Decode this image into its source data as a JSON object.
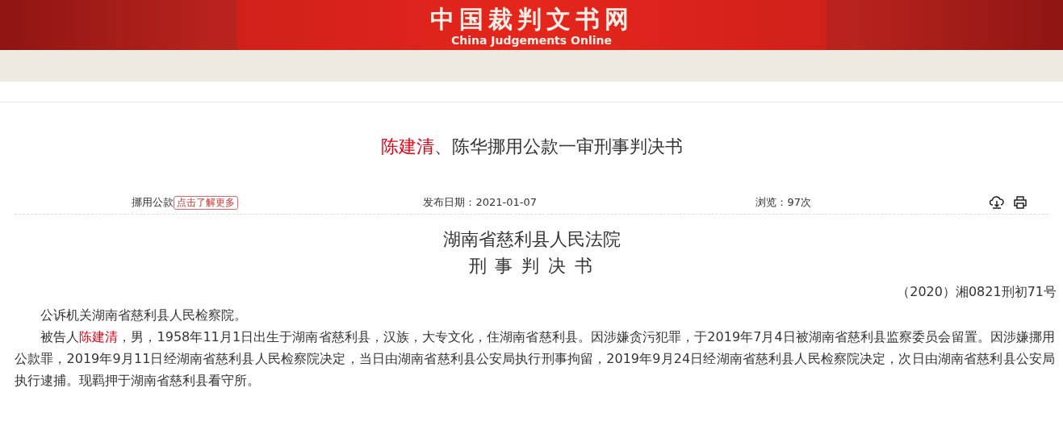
{
  "header": {
    "title": "中国裁判文书网",
    "subtitle": "China Judgements Online"
  },
  "document": {
    "title_parts": [
      {
        "text": "陈建清",
        "highlight": true
      },
      {
        "text": "、陈华挪用公款一审刑事判决书",
        "highlight": false
      }
    ],
    "cause": "挪用公款",
    "more_link": "点击了解更多",
    "publish_date": "发布日期：2021-01-07",
    "views": "浏览：97次",
    "court": "湖南省慈利县人民法院",
    "doc_type": "刑 事 判 决 书",
    "case_number": "（2020）湘0821刑初71号",
    "paragraphs": [
      [
        {
          "text": "公诉机关湖南省慈利县人民检察院。",
          "highlight": false
        }
      ],
      [
        {
          "text": "被告人",
          "highlight": false
        },
        {
          "text": "陈建清",
          "highlight": true
        },
        {
          "text": "，男，1958年11月1日出生于湖南省慈利县，汉族，大专文化，住湖南省慈利县。因涉嫌贪污犯罪，于2019年7月4日被湖南省慈利县监察委员会留置。因涉嫌挪用公款罪，2019年9月11日经湖南省慈利县人民检察院决定，当日由湖南省慈利县公安局执行刑事拘留，2019年9月24日经湖南省慈利县人民检察院决定，次日由湖南省慈利县公安局执行逮捕。现羁押于湖南省慈利县看守所。",
          "highlight": false
        }
      ]
    ]
  }
}
